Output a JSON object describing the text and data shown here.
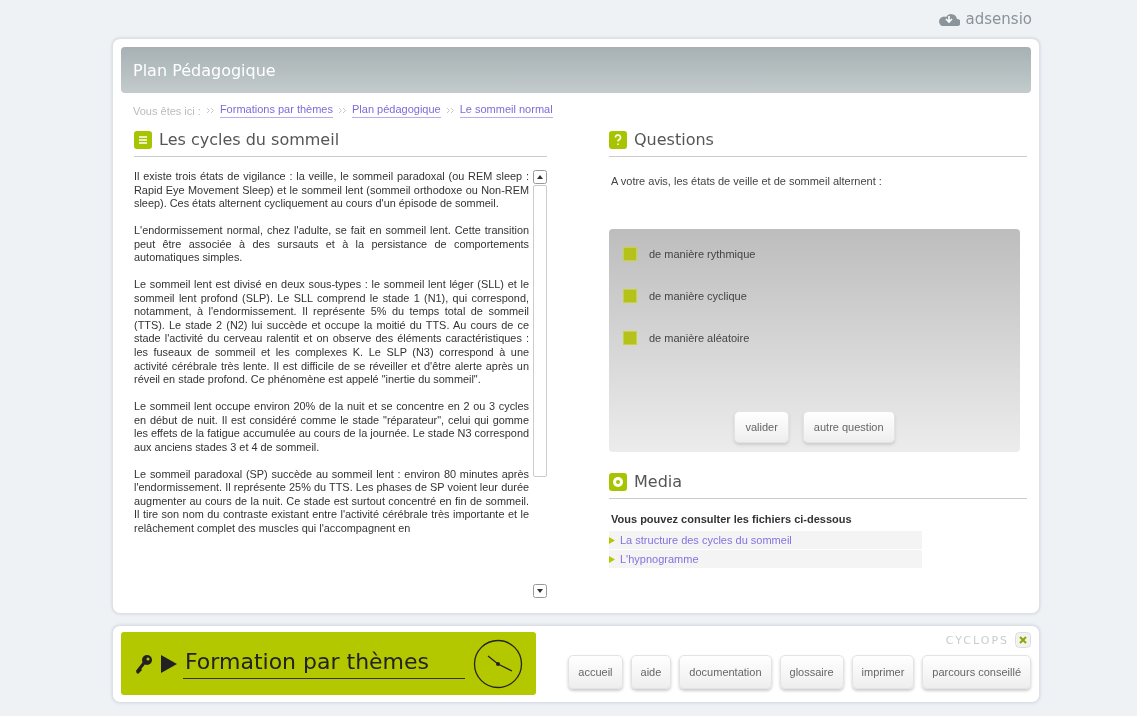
{
  "brand": "adsensio",
  "header": {
    "title": "Plan Pédagogique"
  },
  "breadcrumb": {
    "label": "Vous êtes ici :",
    "items": [
      "Formations par thèmes",
      "Plan pédagogique",
      "Le sommeil normal"
    ]
  },
  "content": {
    "title": "Les cycles du sommeil",
    "paragraphs": [
      "Il existe trois états de vigilance : la veille, le sommeil paradoxal (ou REM sleep : Rapid Eye Movement Sleep) et le sommeil lent (sommeil orthodoxe ou Non-REM sleep). Ces états alternent cycliquement au cours d'un épisode de sommeil.",
      "L'endormissement normal, chez l'adulte, se fait en sommeil lent. Cette transition peut être associée à des sursauts et à la persistance de comportements automatiques simples.",
      "Le sommeil lent est divisé en deux sous-types : le sommeil lent léger (SLL) et le sommeil lent profond (SLP). Le SLL comprend le stade 1 (N1), qui correspond, notamment, à l'endormissement. Il représente 5% du temps total de sommeil (TTS). Le stade 2 (N2) lui succède et occupe la moitié du TTS. Au cours de ce stade l'activité du cerveau ralentit et on observe des éléments caractéristiques : les fuseaux de sommeil et les complexes K. Le SLP (N3) correspond à une activité cérébrale très lente. Il est difficile de se réveiller et d'être alerte après un réveil en stade profond. Ce phénomène est appelé \"inertie du sommeil\".",
      "Le sommeil lent occupe environ 20% de la nuit et se concentre en 2 ou 3 cycles en début de nuit. Il est considéré comme le stade \"réparateur\", celui qui gomme les effets de la fatigue accumulée au cours de la journée. Le stade N3 correspond aux anciens stades 3 et 4 de sommeil.",
      "Le sommeil paradoxal (SP) succède au sommeil lent : environ 80 minutes après l'endormissement. Il représente 25% du TTS. Les phases de SP voient leur durée augmenter au cours de la nuit. Ce stade est surtout concentré en fin de sommeil. Il tire son nom du contraste existant entre l'activité cérébrale très importante et le relâchement complet des muscles qui l'accompagnent en"
    ]
  },
  "questions": {
    "title": "Questions",
    "prompt": "A votre avis, les états de veille et de sommeil alternent :",
    "options": [
      {
        "label": "de manière rythmique",
        "checked": false
      },
      {
        "label": "de manière cyclique",
        "checked": false
      },
      {
        "label": "de manière aléatoire",
        "checked": false
      }
    ],
    "buttons": [
      "valider",
      "autre question"
    ]
  },
  "media": {
    "title": "Media",
    "intro": "Vous pouvez consulter les fichiers ci-dessous",
    "files": [
      "La structure des cycles du sommeil",
      "L'hypnogramme"
    ]
  },
  "footer": {
    "title": "Formation par thèmes",
    "logo": "CYCLOPS",
    "buttons": [
      "accueil",
      "aide",
      "documentation",
      "glossaire",
      "imprimer",
      "parcours conseillé"
    ]
  }
}
